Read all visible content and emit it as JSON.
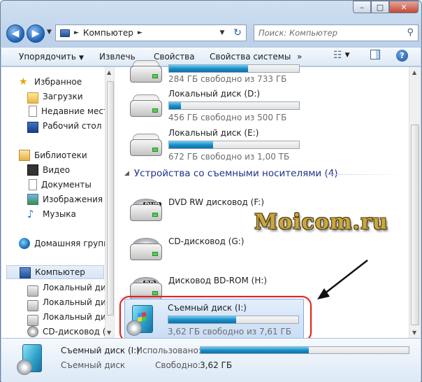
{
  "window": {
    "min_glyph": "–",
    "max_glyph": "□",
    "close_glyph": "✕"
  },
  "nav": {
    "back_glyph": "◀",
    "forward_glyph": "▶",
    "address_path": "Компьютер",
    "address_sep": "►",
    "search_placeholder": "Поиск: Компьютер"
  },
  "toolbar": {
    "organize": "Упорядочить",
    "eject": "Извлечь",
    "properties": "Свойства",
    "system_properties": "Свойства системы",
    "more": "»",
    "help": "?"
  },
  "sidebar": {
    "favorites": "Избранное",
    "downloads": "Загрузки",
    "recent": "Недавние места",
    "desktop": "Рабочий стол",
    "libraries": "Библиотеки",
    "video": "Видео",
    "documents": "Документы",
    "pictures": "Изображения",
    "music": "Музыка",
    "homegroup": "Домашняя группа",
    "computer": "Компьютер",
    "local1": "Локальный диск",
    "local2": "Локальный диск",
    "local3": "Локальный диск",
    "cd": "CD-дисковод (G:"
  },
  "drives": {
    "c_free": "284 ГБ свободно из 733 ГБ",
    "c_fill": 0.61,
    "d_name": "Локальный диск (D:)",
    "d_free": "456 ГБ свободно из 500 ГБ",
    "d_fill": 0.09,
    "e_name": "Локальный диск (E:)",
    "e_free": "672 ГБ свободно из 1,00 ТБ",
    "e_fill": 0.34,
    "removable_header": "Устройства со съемными носителями (4)",
    "f_name": "DVD RW дисковод (F:)",
    "f_tag": "DVD",
    "g_name": "CD-дисковод (G:)",
    "h_name": "Дисковод BD-ROM (H:)",
    "h_tag": "BD",
    "i_name": "Съемный диск (I:)",
    "i_free": "3,62 ГБ свободно из 7,61 ГБ",
    "i_fill": 0.52
  },
  "watermark": "Moicom.ru",
  "details": {
    "name": "Съемный диск (I:)",
    "type": "Съемный диск",
    "used_label": "Использовано:",
    "free_label": "Свободно:",
    "free_value": "3,62 ГБ",
    "used_fill": 0.52
  }
}
